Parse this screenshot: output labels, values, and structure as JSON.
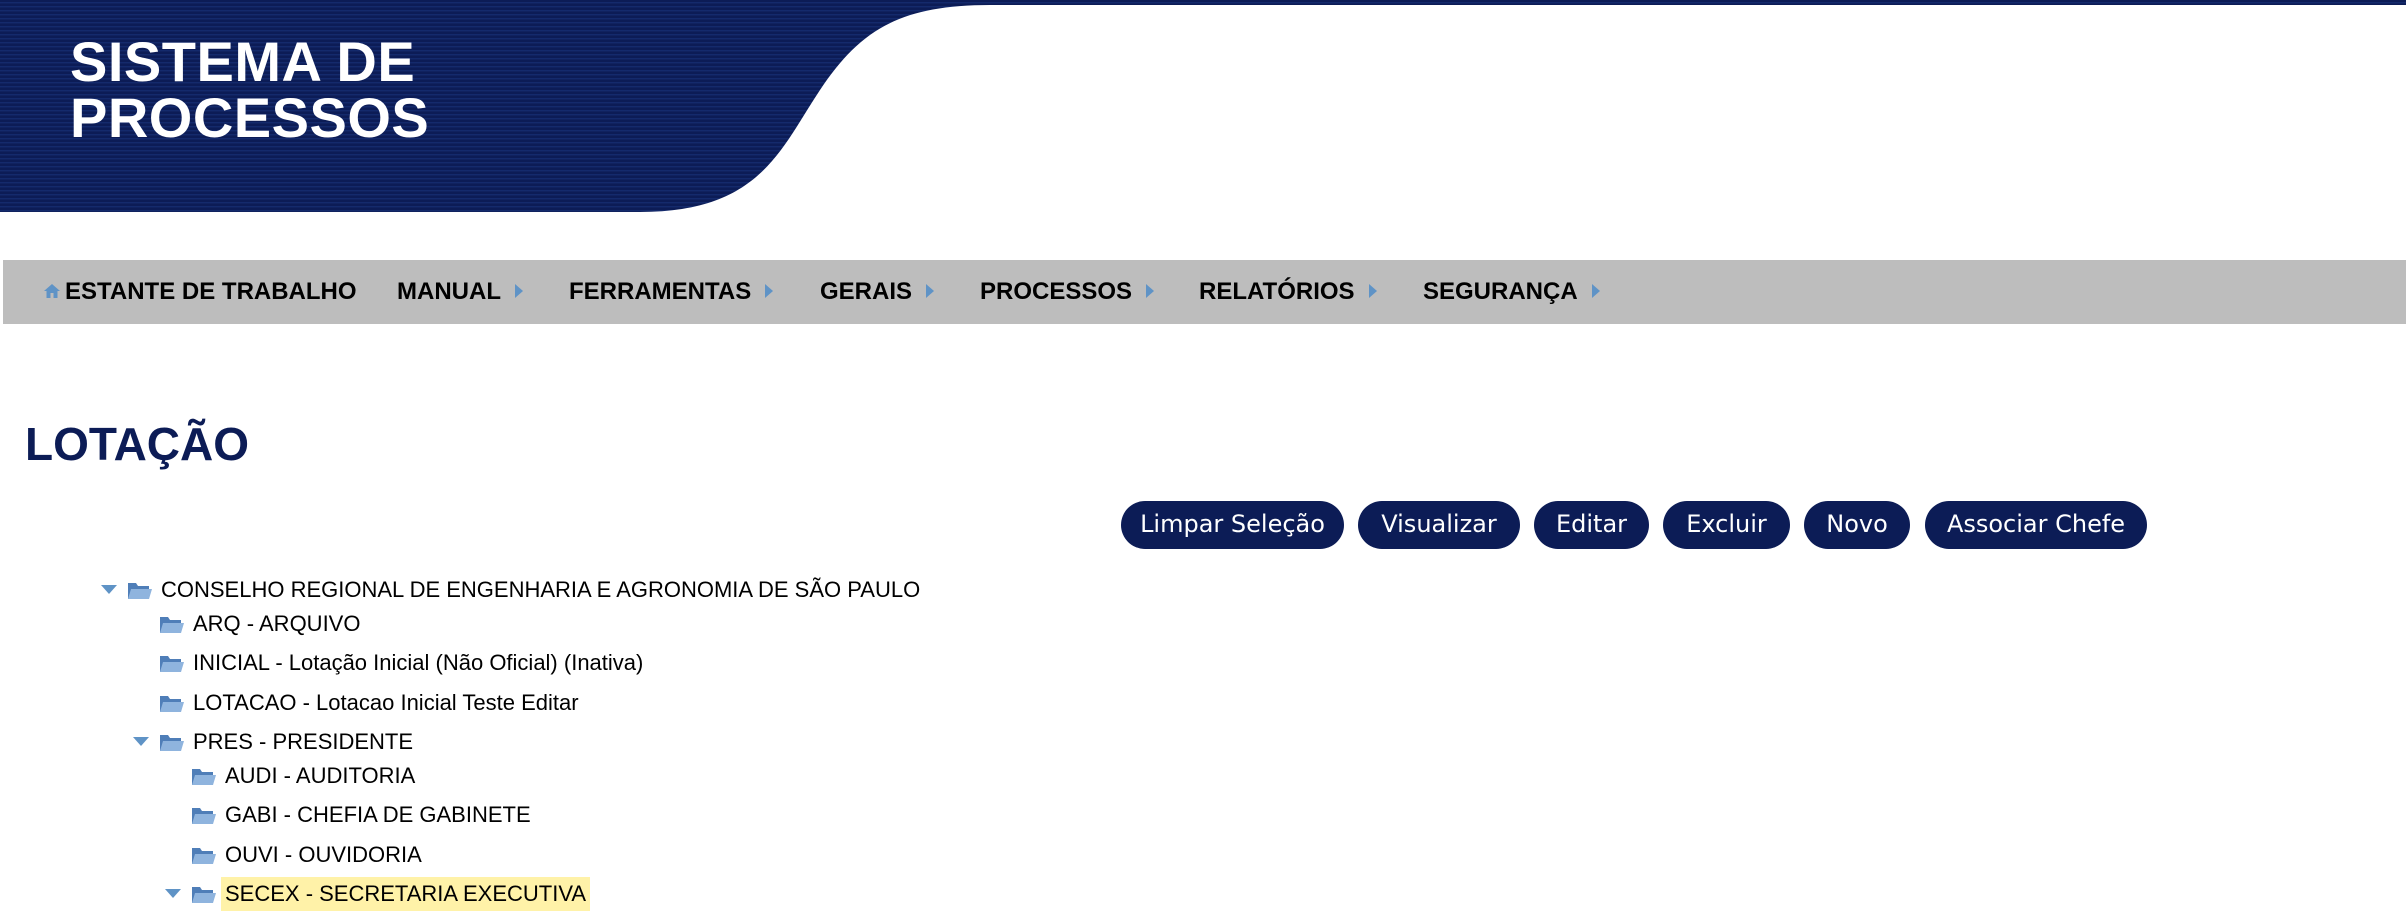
{
  "header": {
    "title_line1": "SISTEMA DE",
    "title_line2": "PROCESSOS"
  },
  "colors": {
    "brand_navy": "#0c1c56",
    "menu_bg": "#bdbdbd",
    "icon_blue": "#5f93c6",
    "selection_highlight": "#fff2a8"
  },
  "menu": {
    "items": [
      {
        "label": "ESTANTE DE TRABALHO",
        "icon": "home-icon"
      },
      {
        "label": "MANUAL",
        "icon": "chevron-right-icon"
      },
      {
        "label": "FERRAMENTAS",
        "icon": "chevron-right-icon"
      },
      {
        "label": "GERAIS",
        "icon": "chevron-right-icon"
      },
      {
        "label": "PROCESSOS",
        "icon": "chevron-right-icon"
      },
      {
        "label": "RELATÓRIOS",
        "icon": "chevron-right-icon"
      },
      {
        "label": "SEGURANÇA",
        "icon": "chevron-right-icon"
      }
    ]
  },
  "page": {
    "title": "LOTAÇÃO"
  },
  "actions": {
    "clear_selection": "Limpar Seleção",
    "view": "Visualizar",
    "edit": "Editar",
    "delete": "Excluir",
    "new": "Novo",
    "assign_chief": "Associar Chefe"
  },
  "tree": {
    "nodes": [
      {
        "label": "CONSELHO REGIONAL DE ENGENHARIA E AGRONOMIA DE SÃO PAULO",
        "expanded": true,
        "selected": false
      },
      {
        "label": "ARQ - ARQUIVO",
        "expanded": false,
        "selected": false
      },
      {
        "label": "INICIAL - Lotação Inicial (Não Oficial) (Inativa)",
        "expanded": false,
        "selected": false
      },
      {
        "label": "LOTACAO - Lotacao Inicial Teste Editar",
        "expanded": false,
        "selected": false
      },
      {
        "label": "PRES - PRESIDENTE",
        "expanded": true,
        "selected": false
      },
      {
        "label": "AUDI - AUDITORIA",
        "expanded": false,
        "selected": false
      },
      {
        "label": "GABI - CHEFIA DE GABINETE",
        "expanded": false,
        "selected": false
      },
      {
        "label": "OUVI - OUVIDORIA",
        "expanded": false,
        "selected": false
      },
      {
        "label": "SECEX - SECRETARIA EXECUTIVA",
        "expanded": true,
        "selected": true
      }
    ]
  }
}
